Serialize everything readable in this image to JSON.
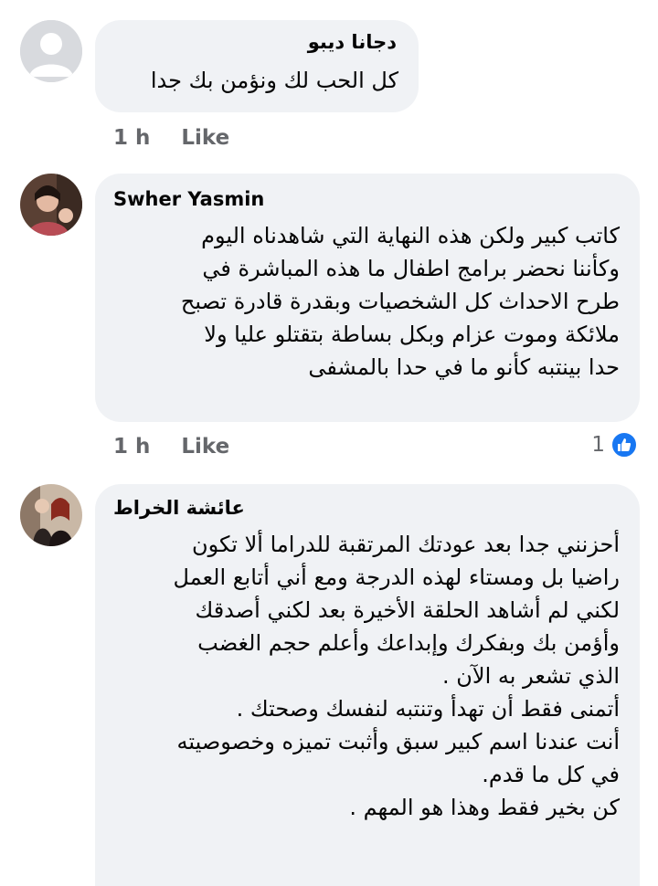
{
  "comments": [
    {
      "author": "دجانا ديبو",
      "text": "كل الحب لك ونؤمن بك جدا",
      "time": "1 h",
      "like_label": "Like",
      "avatar": "default-profile-icon"
    },
    {
      "author": "Swher Yasmin",
      "text": "كاتب كبير ولكن هذه النهاية التي شاهدناه اليوم\nوكأننا نحضر برامج اطفال ما هذه المباشرة في\nطرح الاحداث كل الشخصيات وبقدرة قادرة تصبح\nملائكة وموت عزام وبكل بساطة بتقتلو عليا ولا\nحدا بينتبه كأنو ما في حدا بالمشفى",
      "time": "1 h",
      "like_label": "Like",
      "reaction_count": "1",
      "reaction_icon": "thumbs-up-icon"
    },
    {
      "author": "عائشة الخراط",
      "text": "أحزنني جدا بعد عودتك المرتقبة للدراما ألا تكون\nراضيا بل ومستاء لهذه الدرجة ومع أني أتابع العمل\nلكني لم أشاهد الحلقة الأخيرة بعد لكني أصدقك\nوأؤمن بك وبفكرك وإبداعك وأعلم حجم الغضب\nالذي تشعر به الآن .\nأتمنى فقط أن تهدأ وتنتبه لنفسك وصحتك .\nأنت عندنا اسم كبير سبق وأثبت تميزه وخصوصيته\nفي كل ما قدم.\nكن بخير فقط وهذا هو المهم ."
    }
  ],
  "colors": {
    "bubble": "#f0f2f5",
    "meta": "#65676b",
    "like_blue": "#1877f2"
  }
}
